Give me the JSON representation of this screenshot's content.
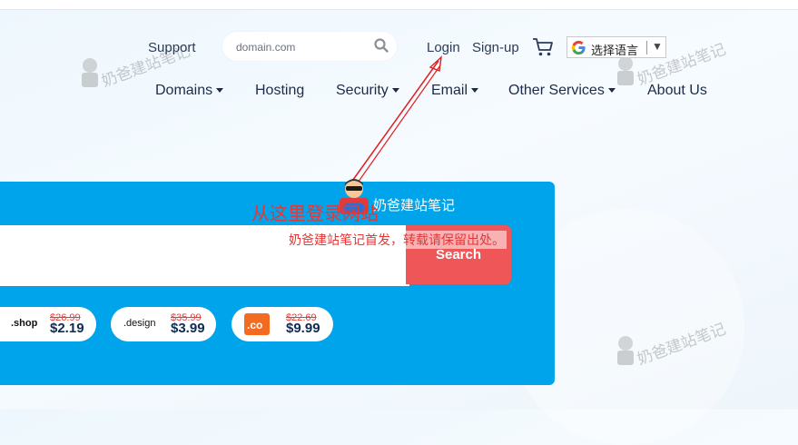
{
  "header": {
    "support_label": "Support",
    "search": {
      "placeholder": "domain.com"
    },
    "login_label": "Login",
    "signup_label": "Sign-up",
    "language": {
      "selected": "选择语言",
      "caret": "▼"
    }
  },
  "nav": {
    "items": [
      {
        "label": "Domains",
        "dropdown": true
      },
      {
        "label": "Hosting",
        "dropdown": false
      },
      {
        "label": "Security",
        "dropdown": true
      },
      {
        "label": "Email",
        "dropdown": true
      },
      {
        "label": "Other Services",
        "dropdown": true
      },
      {
        "label": "About Us",
        "dropdown": false
      }
    ]
  },
  "hero": {
    "search_button_label": "Search",
    "accent_color": "#00a4ea",
    "button_color": "#ef5657",
    "tlds": [
      {
        "name": ".shop",
        "old_price": "$26.99",
        "new_price": "$2.19"
      },
      {
        "name": ".design",
        "old_price": "$35.99",
        "new_price": "$3.99"
      },
      {
        "name": ".co",
        "old_price": "$22.69",
        "new_price": "$9.99"
      }
    ]
  },
  "annotations": {
    "arrow_caption": "从这里登录网站",
    "mascot_caption": "奶爸建站笔记",
    "repost_notice": "奶爸建站笔记首发，转载请保留出处。",
    "watermark": "奶爸建站笔记"
  }
}
